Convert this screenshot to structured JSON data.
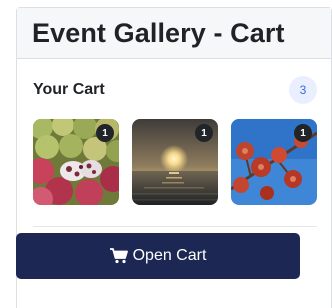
{
  "header": {
    "title": "Event Gallery - Cart"
  },
  "cart": {
    "label": "Your Cart",
    "count": "3",
    "items": [
      {
        "image": "fruits-photo",
        "quantity": "1"
      },
      {
        "image": "sunset-sea-photo",
        "quantity": "1"
      },
      {
        "image": "red-blossom-photo",
        "quantity": "1"
      }
    ]
  },
  "actions": {
    "open_cart_label": "Open Cart",
    "open_cart_icon": "shopping-cart-icon"
  },
  "colors": {
    "button": "#1c2754",
    "badge_bg": "#e9efff",
    "badge_text": "#3a6ae0",
    "qty_bg": "#212529"
  }
}
